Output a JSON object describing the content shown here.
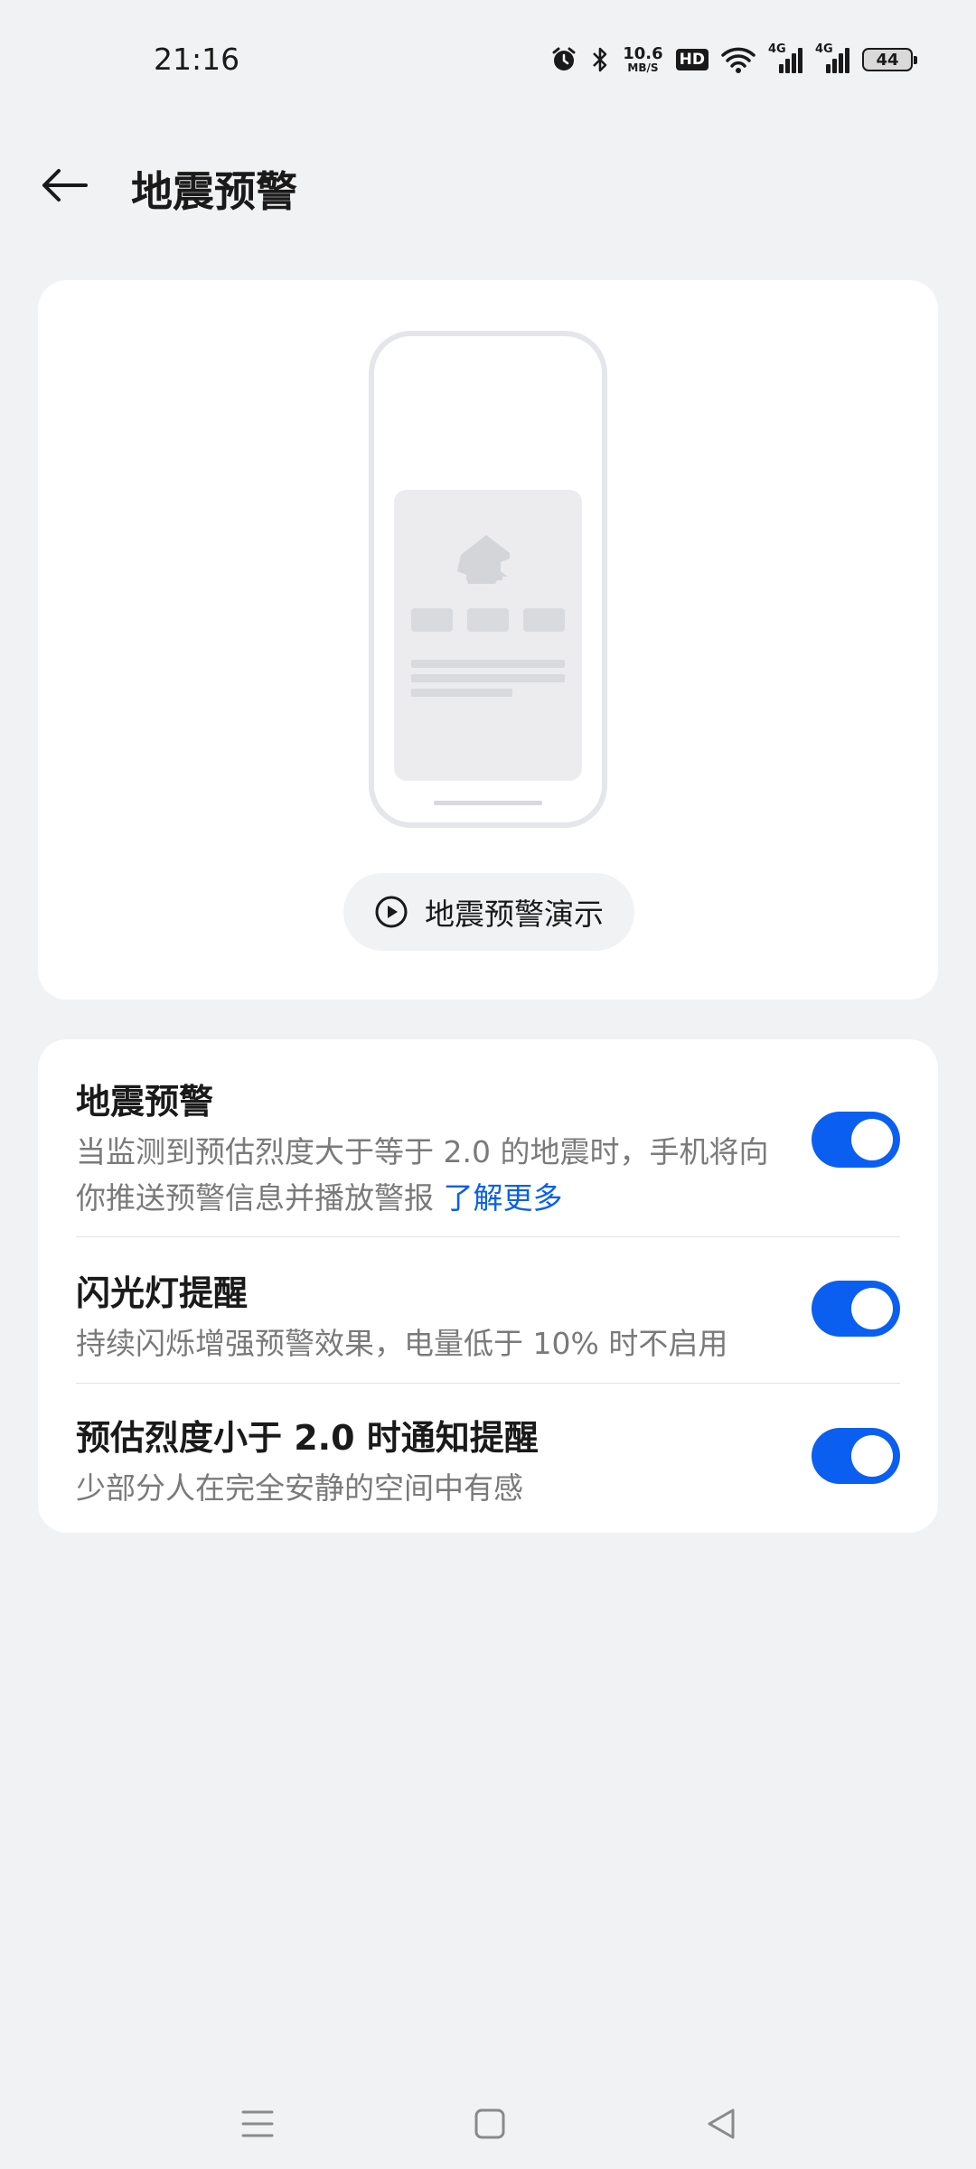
{
  "status_bar": {
    "time": "21:16",
    "net_speed_value": "10.6",
    "net_speed_unit": "MB/S",
    "hd_label": "HD",
    "signal1_label": "4G",
    "signal2_label": "4G",
    "battery": "44",
    "icons": [
      "alarm-icon",
      "bluetooth-icon",
      "hd-icon",
      "wifi-icon",
      "signal-icon",
      "signal-icon",
      "battery-icon"
    ]
  },
  "header": {
    "title": "地震预警",
    "back_icon": "arrow-left-icon"
  },
  "preview": {
    "demo_label": "地震预警演示",
    "demo_icon": "play-circle-icon"
  },
  "settings": {
    "earthquake_alert": {
      "title": "地震预警",
      "desc": "当监测到预估烈度大于等于 2.0 的地震时，手机将向你推送预警信息并播放警报 ",
      "link": "了解更多",
      "enabled": true
    },
    "flash_alert": {
      "title": "闪光灯提醒",
      "desc": "持续闪烁增强预警效果，电量低于 10% 时不启用",
      "enabled": true
    },
    "low_intensity_notify": {
      "title": "预估烈度小于 2.0 时通知提醒",
      "desc": "少部分人在完全安静的空间中有感",
      "enabled": true
    }
  },
  "colors": {
    "accent": "#0a5ff0",
    "link": "#0a60e8",
    "background": "#f1f2f4",
    "card": "#ffffff"
  },
  "nav_bar": {
    "icons": [
      "menu-icon",
      "home-square-icon",
      "back-triangle-icon"
    ]
  }
}
